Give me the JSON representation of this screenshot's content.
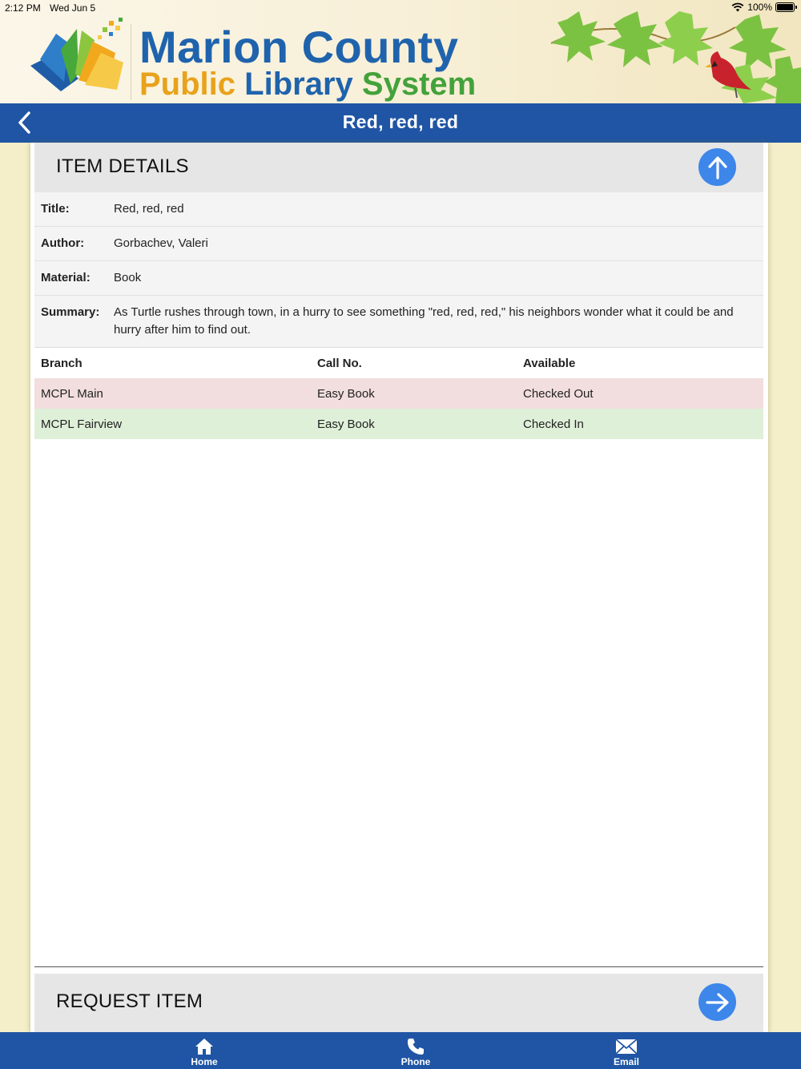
{
  "status_bar": {
    "time": "2:12 PM",
    "date": "Wed Jun 5",
    "battery": "100%"
  },
  "banner": {
    "line1": "Marion County",
    "line2_public": "Public",
    "line2_library": "Library",
    "line2_system": "System",
    "colors": {
      "blue": "#1f63ad",
      "orange": "#e8a21b",
      "green": "#43a23b"
    }
  },
  "nav": {
    "title": "Red, red, red"
  },
  "item_details": {
    "heading": "ITEM DETAILS",
    "fields": [
      {
        "label": "Title:",
        "value": "Red, red, red"
      },
      {
        "label": "Author:",
        "value": "Gorbachev, Valeri"
      },
      {
        "label": "Material:",
        "value": "Book"
      },
      {
        "label": "Summary:",
        "value": "As Turtle rushes through town, in a hurry to see something \"red, red, red,\" his neighbors wonder what it could be and hurry after him to find out."
      }
    ]
  },
  "holdings": {
    "headers": {
      "branch": "Branch",
      "call_no": "Call No.",
      "available": "Available"
    },
    "rows": [
      {
        "branch": "MCPL Main",
        "call_no": "Easy Book",
        "available": "Checked Out",
        "status": "out"
      },
      {
        "branch": "MCPL Fairview",
        "call_no": "Easy Book",
        "available": "Checked In",
        "status": "in"
      }
    ]
  },
  "request": {
    "heading": "REQUEST ITEM"
  },
  "tabs": [
    {
      "label": "Home",
      "icon": "home-icon"
    },
    {
      "label": "Phone",
      "icon": "phone-icon"
    },
    {
      "label": "Email",
      "icon": "email-icon"
    }
  ],
  "colors": {
    "nav_blue": "#1f55a4",
    "accent_blue": "#3d86ea",
    "checked_out": "#f2dede",
    "checked_in": "#dff0d8"
  }
}
